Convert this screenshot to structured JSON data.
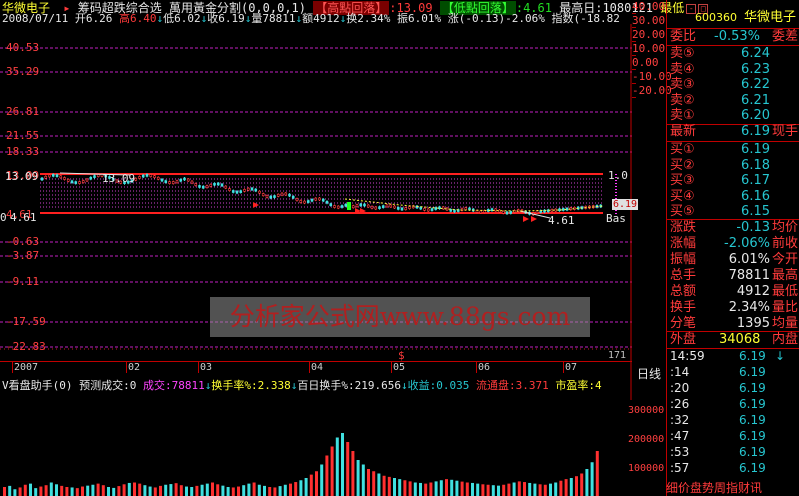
{
  "header": {
    "stock_name": "华微电子",
    "indicator_name": "筹码超跌综合选",
    "subtitle": "萬用黃金分割(0,0,0,1)",
    "high_tag": "【高點回落】",
    "high_value": ":13.09",
    "low_tag": "【低點回落】",
    "low_value": ":4.61",
    "max_day_label": "最高日:1080121",
    "min_label": "最低",
    "date": "2008/07/11",
    "open": "开6.26",
    "high": "高6.40",
    "low": "低6.02",
    "close": "收6.19",
    "volume": "量78811",
    "amount": "额4912",
    "turnover": "换2.34%",
    "amplitude": "振6.01%",
    "change": "涨(-0.13)-2.06%",
    "index": "指数(-18.82"
  },
  "price_axis_left": [
    "40.53",
    "35.29",
    "26.81",
    "21.55",
    "18.33",
    "13.09",
    "4.61",
    "-0.63",
    "-3.87",
    "-9.11",
    "-17.59",
    "-22.83"
  ],
  "price_axis_right": [
    "40.00",
    "30.00",
    "20.00",
    "10.00",
    "0.00",
    "-10.00",
    "-20.00"
  ],
  "chart_annotations": {
    "high_label": "13.09",
    "low_label": "4.61",
    "current_price": "6.19",
    "right_mark": "1.0",
    "base_label": "Bas"
  },
  "time_axis": [
    "2007",
    "02",
    "03",
    "04",
    "05",
    "06",
    "07"
  ],
  "time_axis_extra": {
    "year": "2008",
    "dollar": "$",
    "count": "171",
    "mode": "日线"
  },
  "volume_panel": {
    "title": "V看盘助手(0)",
    "predict": "预测成交:0",
    "vol_label": "成交:78811",
    "turnover_label": "换手率%:2.338",
    "hundred_turnover": "百日换手%:219.656",
    "income": "收益:0.035",
    "float_cap": "流通盘:3.371",
    "pe": "市盈率:4",
    "axis": [
      "300000",
      "200000",
      "100000"
    ],
    "volumes": [
      40,
      45,
      30,
      38,
      50,
      55,
      35,
      42,
      48,
      60,
      52,
      45,
      40,
      38,
      35,
      42,
      46,
      50,
      55,
      48,
      40,
      36,
      44,
      52,
      58,
      60,
      55,
      48,
      42,
      38,
      45,
      50,
      53,
      57,
      48,
      42,
      40,
      45,
      50,
      55,
      60,
      52,
      46,
      40,
      38,
      42,
      48,
      55,
      60,
      50,
      45,
      40,
      38,
      44,
      50,
      55,
      62,
      70,
      80,
      95,
      110,
      140,
      180,
      220,
      260,
      280,
      240,
      200,
      160,
      140,
      120,
      110,
      100,
      90,
      85,
      80,
      75,
      70,
      65,
      60,
      58,
      55,
      60,
      65,
      70,
      75,
      72,
      68,
      64,
      60,
      58,
      55,
      52,
      50,
      48,
      46,
      50,
      55,
      60,
      65,
      62,
      58,
      55,
      52,
      50,
      55,
      60,
      68,
      75,
      80,
      88,
      100,
      120,
      150,
      200
    ]
  },
  "right_panel": {
    "code": "600360",
    "name": "华微电子",
    "weibi_label": "委比",
    "weibi_value": "-0.53%",
    "weicha_label": "委差",
    "sells": [
      {
        "label": "卖⑤",
        "price": "6.24"
      },
      {
        "label": "卖④",
        "price": "6.23"
      },
      {
        "label": "卖③",
        "price": "6.22"
      },
      {
        "label": "卖②",
        "price": "6.21"
      },
      {
        "label": "卖①",
        "price": "6.20"
      }
    ],
    "last_label": "最新",
    "last_price": "6.19",
    "last_tail": "现手",
    "buys": [
      {
        "label": "买①",
        "price": "6.19"
      },
      {
        "label": "买②",
        "price": "6.18"
      },
      {
        "label": "买③",
        "price": "6.17"
      },
      {
        "label": "买④",
        "price": "6.16"
      },
      {
        "label": "买⑤",
        "price": "6.15"
      }
    ],
    "stats": [
      {
        "label": "涨跌",
        "value": "-0.13",
        "tail": "均价"
      },
      {
        "label": "涨幅",
        "value": "-2.06%",
        "tail": "前收"
      },
      {
        "label": "振幅",
        "value": "6.01%",
        "tail": "今开"
      },
      {
        "label": "总手",
        "value": "78811",
        "tail": "最高"
      },
      {
        "label": "总额",
        "value": "4912",
        "tail": "最低"
      },
      {
        "label": "换手",
        "value": "2.34%",
        "tail": "量比"
      },
      {
        "label": "分笔",
        "value": "1395",
        "tail": "均量"
      }
    ],
    "outer_label": "外盘",
    "outer_value": "34068",
    "inner_label": "内盘",
    "ticks": [
      {
        "time": "14:59",
        "price": "6.19",
        "vol": "↓"
      },
      {
        "time": ":14",
        "price": "6.19",
        "vol": ""
      },
      {
        "time": ":20",
        "price": "6.19",
        "vol": ""
      },
      {
        "time": ":26",
        "price": "6.19",
        "vol": ""
      },
      {
        "time": ":32",
        "price": "6.19",
        "vol": ""
      },
      {
        "time": ":47",
        "price": "6.19",
        "vol": ""
      },
      {
        "time": ":53",
        "price": "6.19",
        "vol": ""
      },
      {
        "time": ":57",
        "price": "6.19",
        "vol": ""
      }
    ],
    "tabs": "细价盘势周指财讯"
  },
  "watermark": "分析家公式网www.88gs.com"
}
